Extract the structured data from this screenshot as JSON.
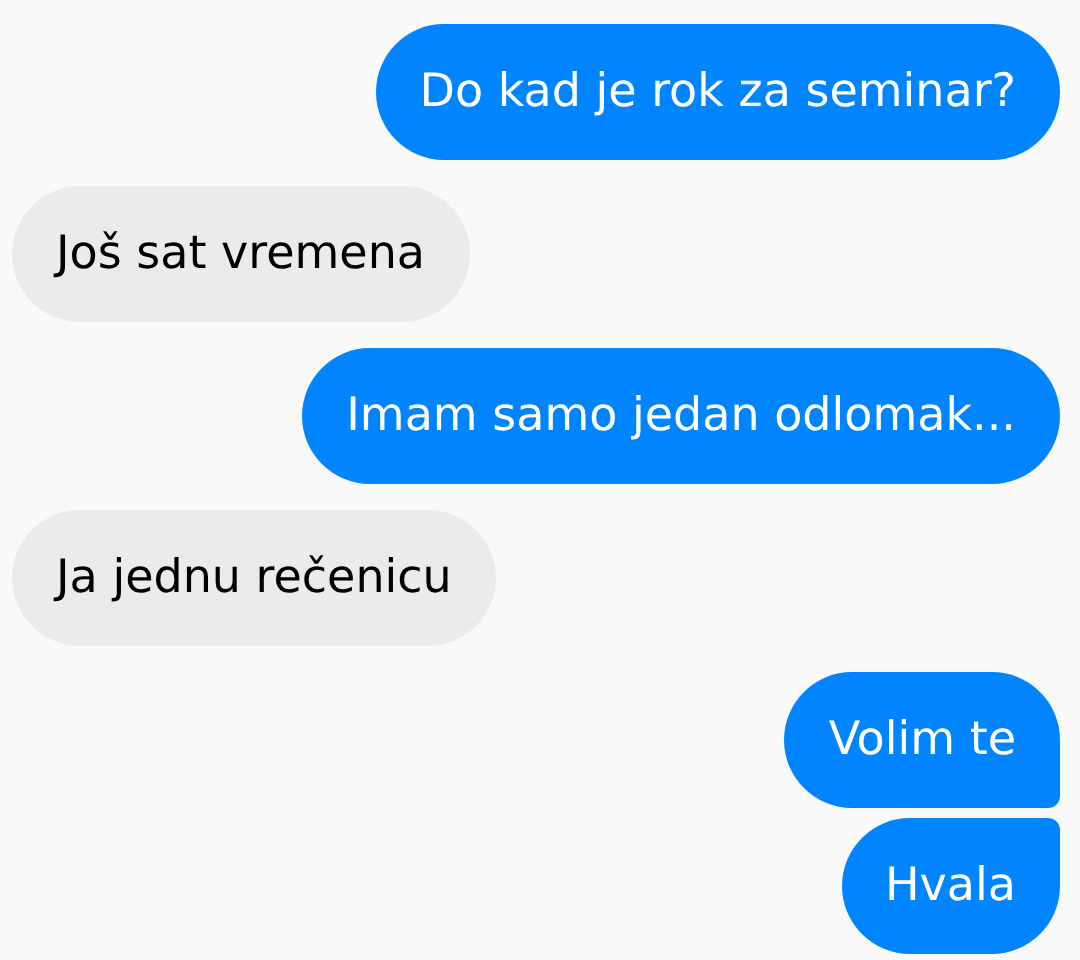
{
  "messages": [
    {
      "kind": "sent",
      "text": "Do kad je rok za seminar?"
    },
    {
      "kind": "received",
      "text": "Još sat vremena"
    },
    {
      "kind": "sent",
      "text": "Imam samo jedan odlomak..."
    },
    {
      "kind": "received",
      "text": "Ja jednu rečenicu"
    },
    {
      "kind": "sent",
      "text": "Volim te"
    },
    {
      "kind": "sent",
      "text": "Hvala"
    }
  ]
}
